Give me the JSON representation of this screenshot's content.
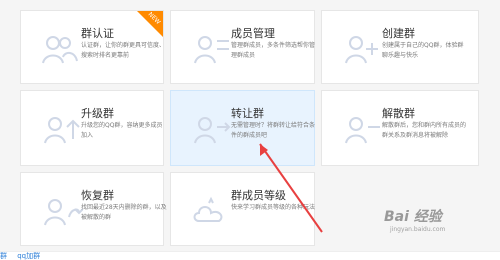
{
  "cards": [
    {
      "title": "群认证",
      "desc": "认证群，让你的群更具可信度、搜索时排名更靠前",
      "badge": "NEW"
    },
    {
      "title": "成员管理",
      "desc": "管理群成员，多条件筛选帮你管理群成员"
    },
    {
      "title": "创建群",
      "desc": "创建属于自己的QQ群，体验群聊乐趣与快乐"
    },
    {
      "title": "升级群",
      "desc": "升级您的QQ群，容纳更多成员加入"
    },
    {
      "title": "转让群",
      "desc": "无需管理时？将群转让给符合条件的群成员吧"
    },
    {
      "title": "解散群",
      "desc": "解散群后，您和群内所有成员的群关系及群消息将被解除"
    },
    {
      "title": "恢复群",
      "desc": "找回最近28天内删除的群，以及被解散的群"
    },
    {
      "title": "群成员等级",
      "desc": "快来学习群成员等级的各种玩法"
    }
  ],
  "bottom_bar": {
    "items": [
      "群",
      "qq加群"
    ]
  },
  "watermark": {
    "brand": "Bai 经验",
    "site": "jingyan.baidu.com"
  },
  "colors": {
    "accent": "#ff8a00",
    "link": "#2d7fd7",
    "arrow": "#e84040",
    "active_bg": "#e8f3fe"
  }
}
